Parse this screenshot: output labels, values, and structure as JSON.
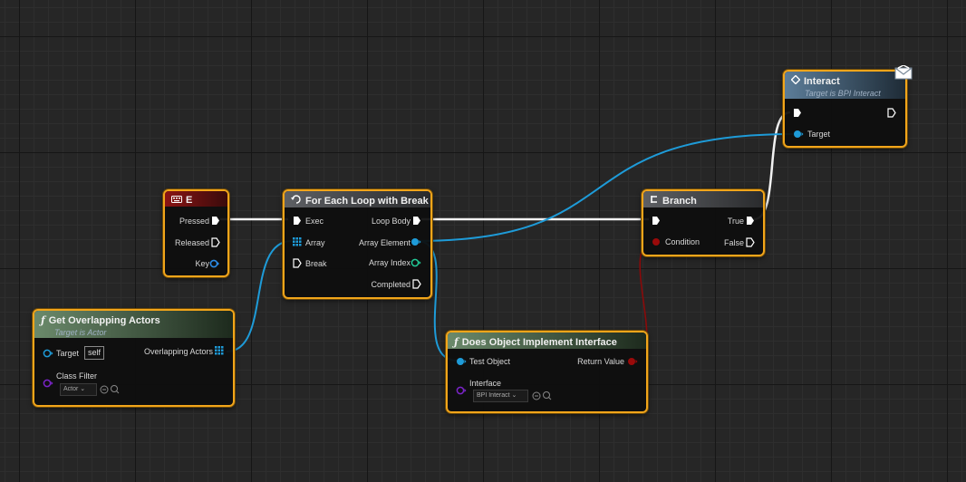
{
  "nodes": {
    "event_e": {
      "title": "E",
      "pressed": "Pressed",
      "released": "Released",
      "key": "Key"
    },
    "for_each": {
      "title": "For Each Loop with Break",
      "exec": "Exec",
      "array": "Array",
      "break": "Break",
      "loop_body": "Loop Body",
      "array_element": "Array Element",
      "array_index": "Array Index",
      "completed": "Completed"
    },
    "branch": {
      "title": "Branch",
      "condition": "Condition",
      "true": "True",
      "false": "False"
    },
    "interact": {
      "title": "Interact",
      "subtitle": "Target is BPI Interact",
      "target": "Target"
    },
    "get_overlapping": {
      "title": "Get Overlapping Actors",
      "subtitle": "Target is Actor",
      "target": "Target",
      "self_value": "self",
      "overlapping_actors": "Overlapping Actors",
      "class_filter": "Class Filter",
      "class_value": "Actor"
    },
    "does_implement": {
      "title": "Does Object Implement Interface",
      "test_object": "Test Object",
      "return_value": "Return Value",
      "interface": "Interface",
      "interface_value": "BPI Interact"
    }
  },
  "colors": {
    "exec": "#ffffff",
    "object": "#1e9bd8",
    "bool": "#9a0a0a",
    "int": "#22c896",
    "class": "#7b24c9",
    "border": "#f2a51a"
  },
  "icons": {
    "event": "keyboard-icon",
    "loop": "loop-macro-icon",
    "branch": "branch-icon",
    "message": "message-icon",
    "function": "function-icon"
  }
}
